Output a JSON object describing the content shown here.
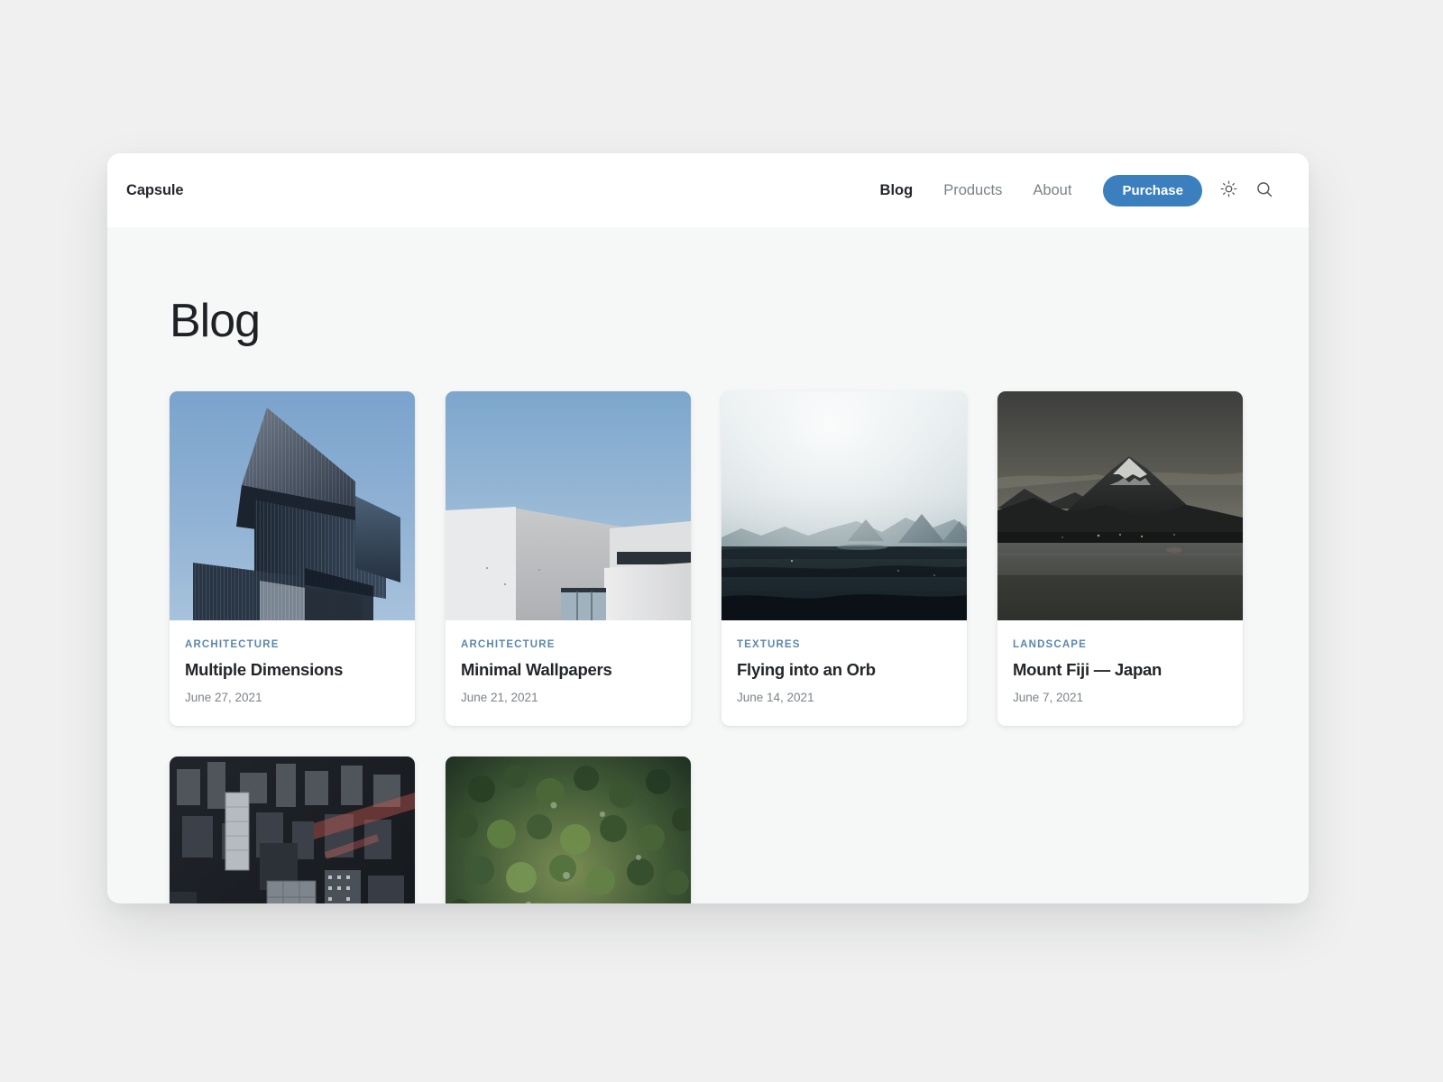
{
  "header": {
    "brand": "Capsule",
    "nav": [
      {
        "label": "Blog",
        "active": true
      },
      {
        "label": "Products",
        "active": false
      },
      {
        "label": "About",
        "active": false
      }
    ],
    "purchase_label": "Purchase",
    "theme_toggle_icon": "sun-icon",
    "search_icon": "search-icon",
    "accent_color": "#3b7fbe"
  },
  "main": {
    "page_title": "Blog",
    "posts": [
      {
        "category": "ARCHITECTURE",
        "title": "Multiple Dimensions",
        "date": "June 27, 2021",
        "image": "angular-glass-building-blue-sky"
      },
      {
        "category": "ARCHITECTURE",
        "title": "Minimal Wallpapers",
        "date": "June 21, 2021",
        "image": "white-concrete-minimal-building"
      },
      {
        "category": "TEXTURES",
        "title": "Flying into an Orb",
        "date": "June 14, 2021",
        "image": "misty-volcanic-plain"
      },
      {
        "category": "LANDSCAPE",
        "title": "Mount Fiji — Japan",
        "date": "June 7, 2021",
        "image": "mount-fuji-dusk-lake"
      },
      {
        "category": "",
        "title": "",
        "date": "",
        "image": "aerial-city-skyscrapers"
      },
      {
        "category": "",
        "title": "",
        "date": "",
        "image": "aerial-pine-forest-canopy"
      }
    ]
  }
}
